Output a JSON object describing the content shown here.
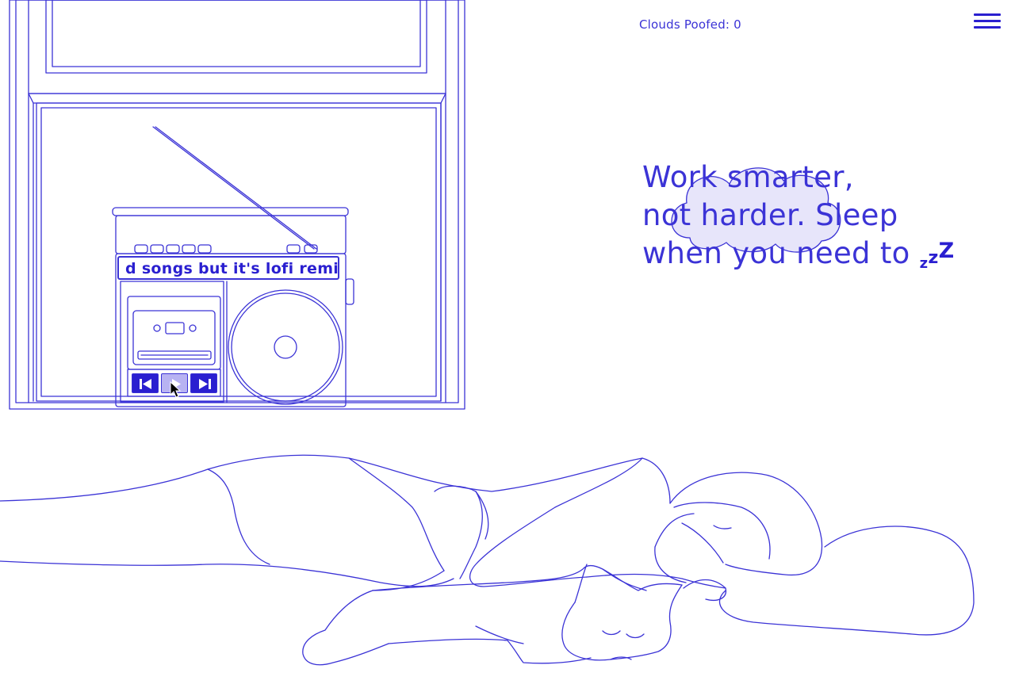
{
  "header": {
    "clouds_counter": "Clouds Poofed: 0",
    "menu_icon": "hamburger-menu-icon"
  },
  "tagline": {
    "line1": "Work smarter,",
    "line2": "not harder. Sleep",
    "line3": "when you need to",
    "zzz": [
      "z",
      "z",
      "Z"
    ]
  },
  "radio": {
    "song_title": "d songs but it's lofi remix",
    "controls": {
      "prev_icon": "skip-previous-icon",
      "play_icon": "play-icon",
      "next_icon": "skip-next-icon"
    }
  },
  "colors": {
    "line": "#3b33d6",
    "accent": "#2a1fd0",
    "cloud_fill": "#c9c5f3",
    "background": "#ffffff"
  }
}
